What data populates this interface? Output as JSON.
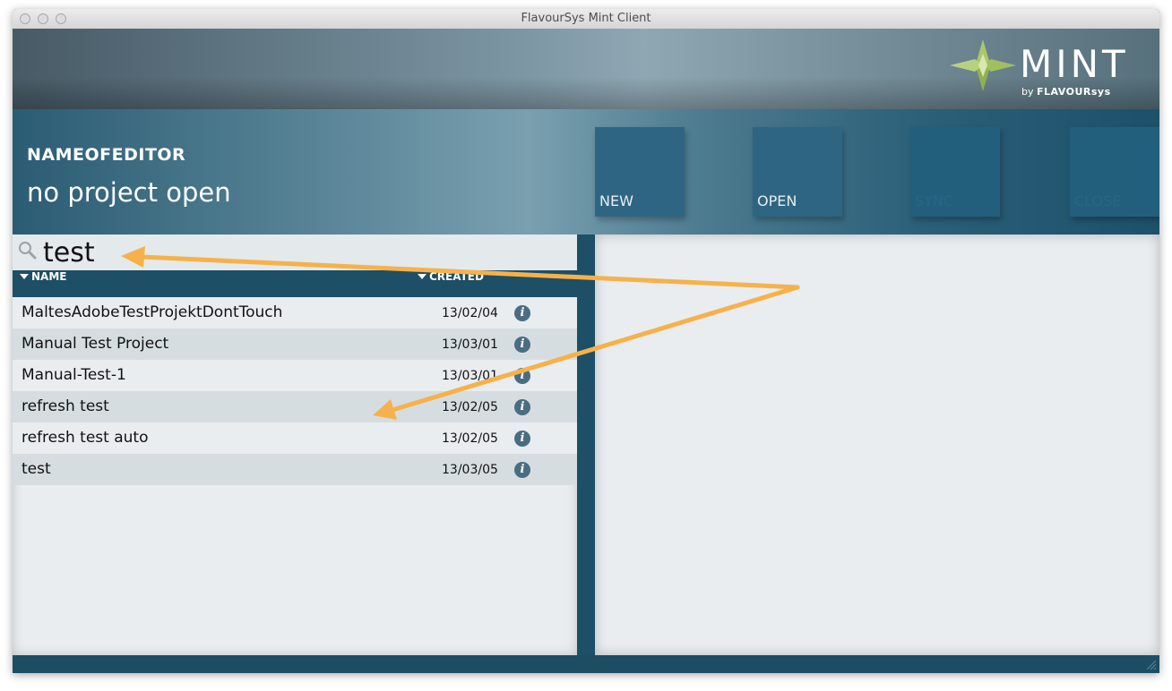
{
  "window": {
    "title": "FlavourSys Mint Client"
  },
  "brand": {
    "logo_text": "MINT",
    "by": "by",
    "company": "FLAVOURsys"
  },
  "editor": {
    "name": "NAMEOFEDITOR",
    "project_status": "no project open"
  },
  "toolbar": {
    "buttons": [
      {
        "label": "NEW",
        "enabled": true
      },
      {
        "label": "OPEN",
        "enabled": true
      },
      {
        "label": "SYNC",
        "enabled": false
      },
      {
        "label": "CLOSE",
        "enabled": false
      }
    ]
  },
  "search": {
    "value": "test"
  },
  "columns": {
    "name": "NAME",
    "created": "CREATED"
  },
  "projects": [
    {
      "name": "MaltesAdobeTestProjektDontTouch",
      "created": "13/02/04"
    },
    {
      "name": "Manual Test Project",
      "created": "13/03/01"
    },
    {
      "name": "Manual-Test-1",
      "created": "13/03/01"
    },
    {
      "name": "refresh test",
      "created": "13/02/05"
    },
    {
      "name": "refresh test auto",
      "created": "13/02/05"
    },
    {
      "name": "test",
      "created": "13/03/05"
    }
  ],
  "colors": {
    "accent": "#1d4f66",
    "tile": "#2e6582",
    "annotation_arrow": "#f7b14a",
    "info_icon": "#4a6d82"
  },
  "icons": [
    "search-icon",
    "info-icon",
    "mint-logo-icon",
    "resize-grip-icon"
  ]
}
